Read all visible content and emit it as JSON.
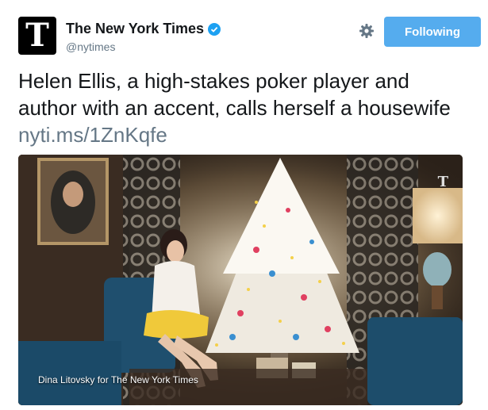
{
  "account": {
    "avatar_letter": "T",
    "display_name": "The New York Times",
    "handle": "@nytimes"
  },
  "actions": {
    "follow_label": "Following"
  },
  "tweet": {
    "text": "Helen Ellis, a high-stakes poker player and author with an accent, calls herself a housewife ",
    "link": "nyti.ms/1ZnKqfe"
  },
  "media": {
    "photo_credit": "Dina Litovsky for The New York Times",
    "watermark": "T"
  },
  "colors": {
    "follow_button": "#55acee",
    "verified": "#1da1f2",
    "link": "#657786"
  }
}
